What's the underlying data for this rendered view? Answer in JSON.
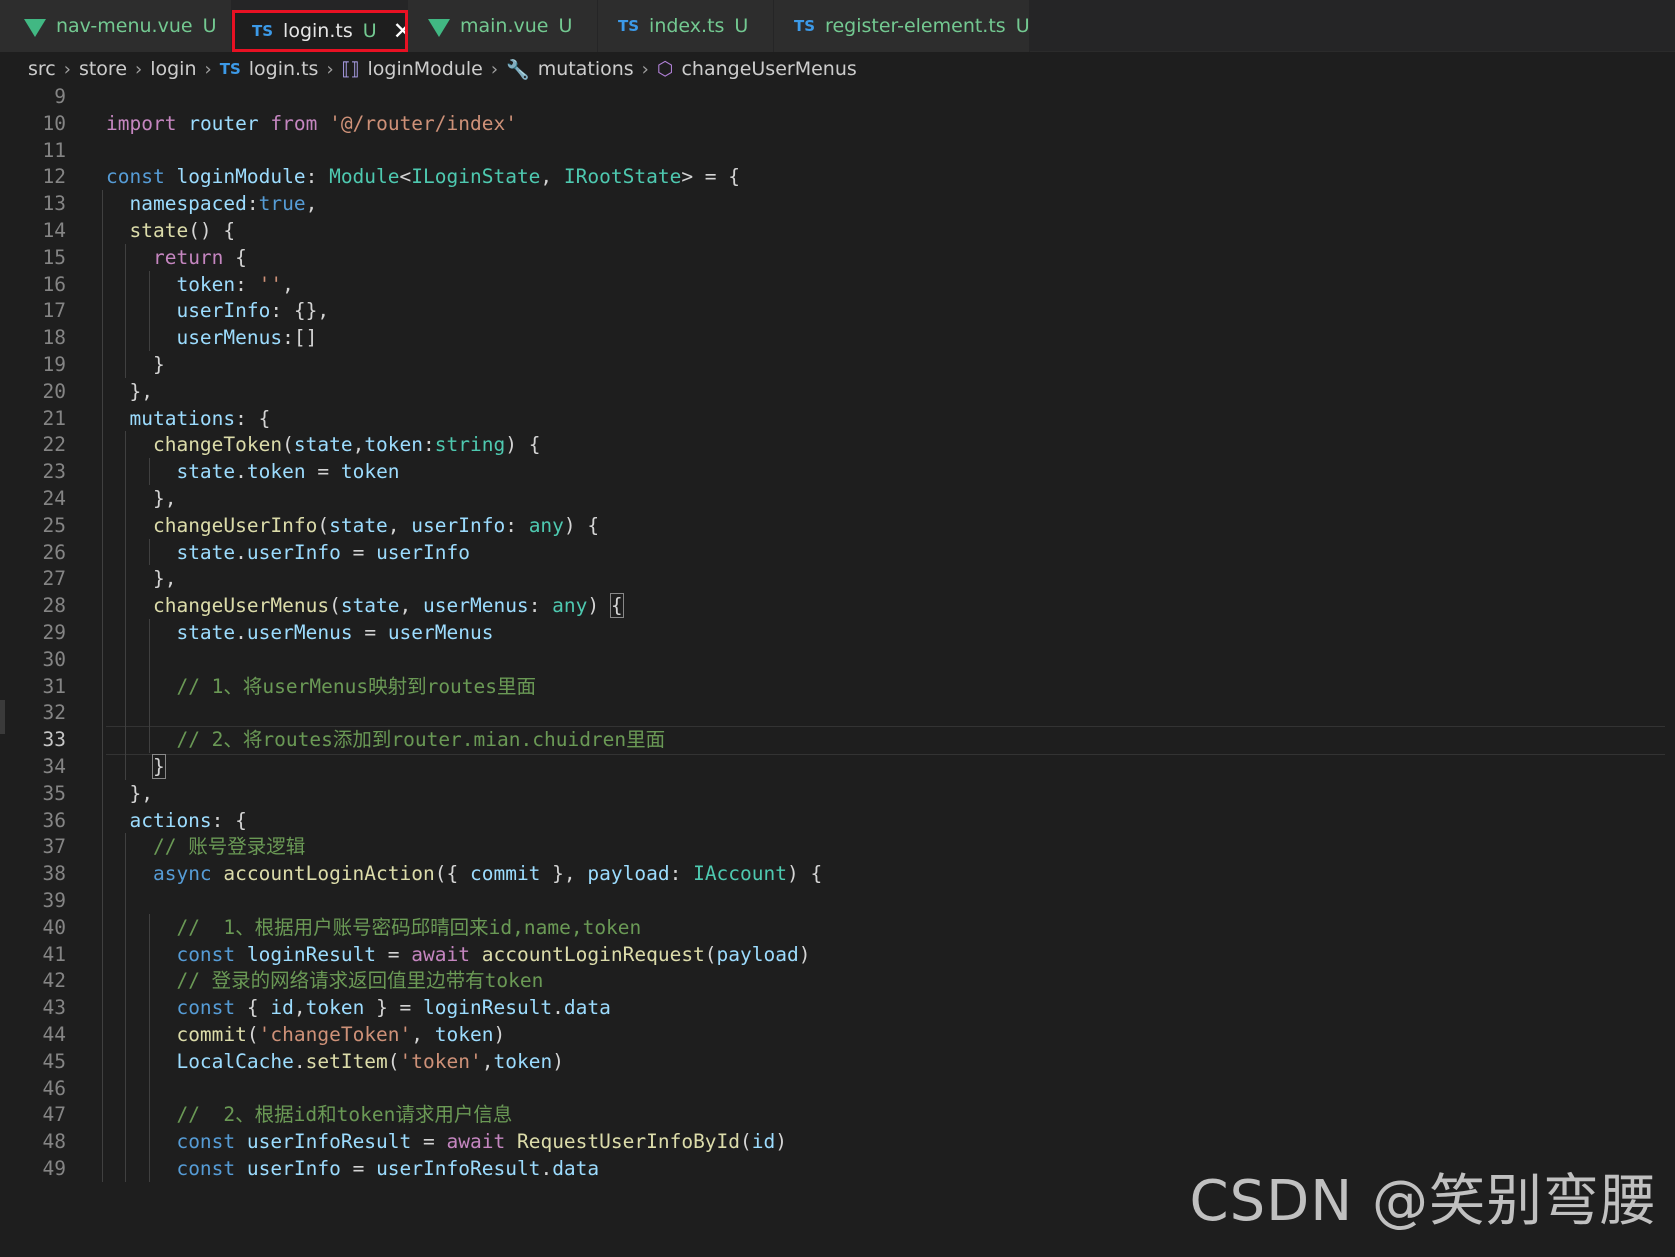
{
  "tabs": [
    {
      "type": "vue",
      "name": "nav-menu.vue",
      "status": "U",
      "active": false
    },
    {
      "type": "ts",
      "name": "login.ts",
      "status": "U",
      "active": true,
      "close": "✕"
    },
    {
      "type": "vue",
      "name": "main.vue",
      "status": "U",
      "active": false
    },
    {
      "type": "ts",
      "name": "index.ts",
      "status": "U",
      "active": false
    },
    {
      "type": "ts",
      "name": "register-element.ts",
      "status": "U",
      "active": false
    }
  ],
  "ts_badge": "TS",
  "breadcrumb": {
    "items": [
      "src",
      "store",
      "login",
      "login.ts",
      "loginModule",
      "mutations",
      "changeUserMenus"
    ],
    "sep": "›"
  },
  "editor": {
    "current_line": 33,
    "lines": [
      {
        "n": "9",
        "tokens": []
      },
      {
        "n": "10",
        "tokens": [
          [
            "k",
            "import"
          ],
          [
            "p",
            " "
          ],
          [
            "v",
            "router"
          ],
          [
            "p",
            " "
          ],
          [
            "k",
            "from"
          ],
          [
            "p",
            " "
          ],
          [
            "s",
            "'@/router/index'"
          ]
        ]
      },
      {
        "n": "11",
        "tokens": []
      },
      {
        "n": "12",
        "tokens": [
          [
            "b",
            "const"
          ],
          [
            "p",
            " "
          ],
          [
            "v",
            "loginModule"
          ],
          [
            "p",
            ": "
          ],
          [
            "t",
            "Module"
          ],
          [
            "p",
            "<"
          ],
          [
            "t",
            "ILoginState"
          ],
          [
            "p",
            ", "
          ],
          [
            "t",
            "IRootState"
          ],
          [
            "p",
            "> = {"
          ]
        ]
      },
      {
        "n": "13",
        "tokens": [
          [
            "p",
            "  "
          ],
          [
            "v",
            "namespaced"
          ],
          [
            "p",
            ":"
          ],
          [
            "b",
            "true"
          ],
          [
            "p",
            ","
          ]
        ]
      },
      {
        "n": "14",
        "tokens": [
          [
            "p",
            "  "
          ],
          [
            "f",
            "state"
          ],
          [
            "p",
            "() {"
          ]
        ]
      },
      {
        "n": "15",
        "tokens": [
          [
            "p",
            "    "
          ],
          [
            "k",
            "return"
          ],
          [
            "p",
            " {"
          ]
        ]
      },
      {
        "n": "16",
        "tokens": [
          [
            "p",
            "      "
          ],
          [
            "v",
            "token"
          ],
          [
            "p",
            ": "
          ],
          [
            "s",
            "''"
          ],
          [
            "p",
            ","
          ]
        ]
      },
      {
        "n": "17",
        "tokens": [
          [
            "p",
            "      "
          ],
          [
            "v",
            "userInfo"
          ],
          [
            "p",
            ": {},"
          ]
        ]
      },
      {
        "n": "18",
        "tokens": [
          [
            "p",
            "      "
          ],
          [
            "v",
            "userMenus"
          ],
          [
            "p",
            ":[]"
          ]
        ]
      },
      {
        "n": "19",
        "tokens": [
          [
            "p",
            "    }"
          ]
        ]
      },
      {
        "n": "20",
        "tokens": [
          [
            "p",
            "  },"
          ]
        ]
      },
      {
        "n": "21",
        "tokens": [
          [
            "p",
            "  "
          ],
          [
            "v",
            "mutations"
          ],
          [
            "p",
            ": {"
          ]
        ]
      },
      {
        "n": "22",
        "tokens": [
          [
            "p",
            "    "
          ],
          [
            "f",
            "changeToken"
          ],
          [
            "p",
            "("
          ],
          [
            "v",
            "state"
          ],
          [
            "p",
            ","
          ],
          [
            "v",
            "token"
          ],
          [
            "p",
            ":"
          ],
          [
            "t",
            "string"
          ],
          [
            "p",
            ") {"
          ]
        ]
      },
      {
        "n": "23",
        "tokens": [
          [
            "p",
            "      "
          ],
          [
            "v",
            "state"
          ],
          [
            "p",
            "."
          ],
          [
            "v",
            "token"
          ],
          [
            "p",
            " = "
          ],
          [
            "v",
            "token"
          ]
        ]
      },
      {
        "n": "24",
        "tokens": [
          [
            "p",
            "    },"
          ]
        ]
      },
      {
        "n": "25",
        "tokens": [
          [
            "p",
            "    "
          ],
          [
            "f",
            "changeUserInfo"
          ],
          [
            "p",
            "("
          ],
          [
            "v",
            "state"
          ],
          [
            "p",
            ", "
          ],
          [
            "v",
            "userInfo"
          ],
          [
            "p",
            ": "
          ],
          [
            "t",
            "any"
          ],
          [
            "p",
            ") {"
          ]
        ]
      },
      {
        "n": "26",
        "tokens": [
          [
            "p",
            "      "
          ],
          [
            "v",
            "state"
          ],
          [
            "p",
            "."
          ],
          [
            "v",
            "userInfo"
          ],
          [
            "p",
            " = "
          ],
          [
            "v",
            "userInfo"
          ]
        ]
      },
      {
        "n": "27",
        "tokens": [
          [
            "p",
            "    },"
          ]
        ]
      },
      {
        "n": "28",
        "tokens": [
          [
            "p",
            "    "
          ],
          [
            "f",
            "changeUserMenus"
          ],
          [
            "p",
            "("
          ],
          [
            "v",
            "state"
          ],
          [
            "p",
            ", "
          ],
          [
            "v",
            "userMenus"
          ],
          [
            "p",
            ": "
          ],
          [
            "t",
            "any"
          ],
          [
            "p",
            ") "
          ],
          [
            "bb",
            "{"
          ]
        ]
      },
      {
        "n": "29",
        "tokens": [
          [
            "p",
            "      "
          ],
          [
            "v",
            "state"
          ],
          [
            "p",
            "."
          ],
          [
            "v",
            "userMenus"
          ],
          [
            "p",
            " = "
          ],
          [
            "v",
            "userMenus"
          ]
        ]
      },
      {
        "n": "30",
        "tokens": []
      },
      {
        "n": "31",
        "tokens": [
          [
            "p",
            "      "
          ],
          [
            "c",
            "// 1、将userMenus映射到routes里面"
          ]
        ]
      },
      {
        "n": "32",
        "tokens": []
      },
      {
        "n": "33",
        "tokens": [
          [
            "p",
            "      "
          ],
          [
            "c",
            "// 2、将routes添加到router.mian.chuidren里面"
          ]
        ]
      },
      {
        "n": "34",
        "tokens": [
          [
            "p",
            "    "
          ],
          [
            "bb",
            "}"
          ]
        ]
      },
      {
        "n": "35",
        "tokens": [
          [
            "p",
            "  },"
          ]
        ]
      },
      {
        "n": "36",
        "tokens": [
          [
            "p",
            "  "
          ],
          [
            "v",
            "actions"
          ],
          [
            "p",
            ": {"
          ]
        ]
      },
      {
        "n": "37",
        "tokens": [
          [
            "p",
            "    "
          ],
          [
            "c",
            "// 账号登录逻辑"
          ]
        ]
      },
      {
        "n": "38",
        "tokens": [
          [
            "p",
            "    "
          ],
          [
            "b",
            "async"
          ],
          [
            "p",
            " "
          ],
          [
            "f",
            "accountLoginAction"
          ],
          [
            "p",
            "({ "
          ],
          [
            "v",
            "commit"
          ],
          [
            "p",
            " }, "
          ],
          [
            "v",
            "payload"
          ],
          [
            "p",
            ": "
          ],
          [
            "t",
            "IAccount"
          ],
          [
            "p",
            ") {"
          ]
        ]
      },
      {
        "n": "39",
        "tokens": []
      },
      {
        "n": "40",
        "tokens": [
          [
            "p",
            "      "
          ],
          [
            "c",
            "//  1、根据用户账号密码邱晴回来id,name,token"
          ]
        ]
      },
      {
        "n": "41",
        "tokens": [
          [
            "p",
            "      "
          ],
          [
            "b",
            "const"
          ],
          [
            "p",
            " "
          ],
          [
            "v",
            "loginResult"
          ],
          [
            "p",
            " = "
          ],
          [
            "k",
            "await"
          ],
          [
            "p",
            " "
          ],
          [
            "f",
            "accountLoginRequest"
          ],
          [
            "p",
            "("
          ],
          [
            "v",
            "payload"
          ],
          [
            "p",
            ")"
          ]
        ]
      },
      {
        "n": "42",
        "tokens": [
          [
            "p",
            "      "
          ],
          [
            "c",
            "// 登录的网络请求返回值里边带有token"
          ]
        ]
      },
      {
        "n": "43",
        "tokens": [
          [
            "p",
            "      "
          ],
          [
            "b",
            "const"
          ],
          [
            "p",
            " { "
          ],
          [
            "v",
            "id"
          ],
          [
            "p",
            ","
          ],
          [
            "v",
            "token"
          ],
          [
            "p",
            " } = "
          ],
          [
            "v",
            "loginResult"
          ],
          [
            "p",
            "."
          ],
          [
            "v",
            "data"
          ]
        ]
      },
      {
        "n": "44",
        "tokens": [
          [
            "p",
            "      "
          ],
          [
            "f",
            "commit"
          ],
          [
            "p",
            "("
          ],
          [
            "s",
            "'changeToken'"
          ],
          [
            "p",
            ", "
          ],
          [
            "v",
            "token"
          ],
          [
            "p",
            ")"
          ]
        ]
      },
      {
        "n": "45",
        "tokens": [
          [
            "p",
            "      "
          ],
          [
            "v",
            "LocalCache"
          ],
          [
            "p",
            "."
          ],
          [
            "f",
            "setItem"
          ],
          [
            "p",
            "("
          ],
          [
            "s",
            "'token'"
          ],
          [
            "p",
            ","
          ],
          [
            "v",
            "token"
          ],
          [
            "p",
            ")"
          ]
        ]
      },
      {
        "n": "46",
        "tokens": []
      },
      {
        "n": "47",
        "tokens": [
          [
            "p",
            "      "
          ],
          [
            "c",
            "//  2、根据id和token请求用户信息"
          ]
        ]
      },
      {
        "n": "48",
        "tokens": [
          [
            "p",
            "      "
          ],
          [
            "b",
            "const"
          ],
          [
            "p",
            " "
          ],
          [
            "v",
            "userInfoResult"
          ],
          [
            "p",
            " = "
          ],
          [
            "k",
            "await"
          ],
          [
            "p",
            " "
          ],
          [
            "f",
            "RequestUserInfoById"
          ],
          [
            "p",
            "("
          ],
          [
            "v",
            "id"
          ],
          [
            "p",
            ")"
          ]
        ]
      },
      {
        "n": "49",
        "tokens": [
          [
            "p",
            "      "
          ],
          [
            "b",
            "const"
          ],
          [
            "p",
            " "
          ],
          [
            "v",
            "userInfo"
          ],
          [
            "p",
            " = "
          ],
          [
            "v",
            "userInfoResult"
          ],
          [
            "p",
            "."
          ],
          [
            "v",
            "data"
          ]
        ]
      }
    ]
  },
  "watermark": "CSDN @笑别弯腰"
}
